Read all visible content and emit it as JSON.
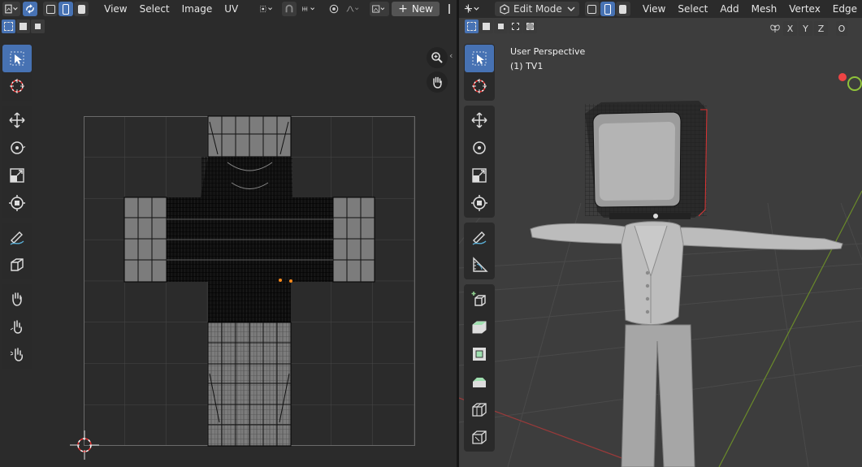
{
  "uv_editor": {
    "menus": [
      "View",
      "Select",
      "Image",
      "UV"
    ],
    "new_label": "New",
    "icons": [
      "image-editor-type-icon",
      "uv-sync-icon",
      "vertex-select-icon",
      "edge-select-icon",
      "face-select-icon",
      "pivot-icon",
      "snap-icon",
      "proportional-icon",
      "falloff-icon",
      "image-browse-icon"
    ]
  },
  "viewport": {
    "mode": "Edit Mode",
    "menus": [
      "View",
      "Select",
      "Add",
      "Mesh",
      "Vertex",
      "Edge"
    ],
    "overlay_title": "User Perspective",
    "overlay_object": "(1) TV1",
    "axes": [
      "X",
      "Y",
      "Z"
    ],
    "options_partial": "O"
  },
  "colors": {
    "active_blue": "#4772b3",
    "uv_bg": "#2b2b2b",
    "viewport_bg": "#3d3d3d",
    "uv_island": "#7c7c7c"
  }
}
